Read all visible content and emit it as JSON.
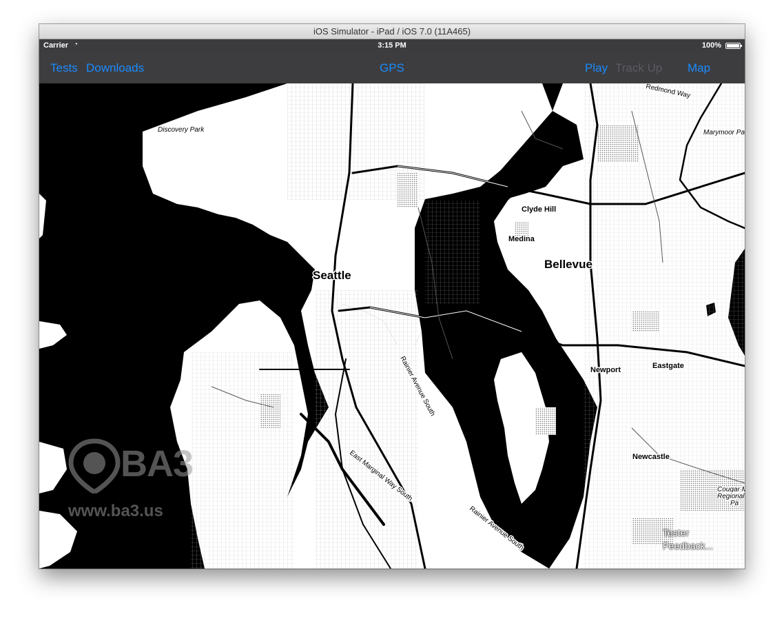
{
  "window": {
    "title": "iOS Simulator - iPad / iOS 7.0 (11A465)"
  },
  "status_bar": {
    "carrier": "Carrier",
    "time": "3:15 PM",
    "battery": "100%"
  },
  "nav_bar": {
    "tests": "Tests",
    "downloads": "Downloads",
    "gps": "GPS",
    "play": "Play",
    "track_up": "Track Up",
    "map": "Map"
  },
  "map": {
    "labels": {
      "discovery_park": "Discovery Park",
      "seattle": "Seattle",
      "clyde_hill": "Clyde Hill",
      "medina": "Medina",
      "bellevue": "Bellevue",
      "newport": "Newport",
      "eastgate": "Eastgate",
      "newcastle": "Newcastle",
      "marymoor": "Marymoor Pa",
      "redmond_way": "Redmond Way",
      "cougar": "Cougar M",
      "regional": "Regional",
      "park": "Pa",
      "rainier_ave_1": "Rainier Avenue South",
      "rainier_ave_2": "Rainier Avenue South",
      "east_marginal": "East Marginal Way South"
    }
  },
  "watermark": {
    "brand": "BA3",
    "url": "www.ba3.us"
  },
  "feedback": {
    "line1": "Tester",
    "line2": "Feedback..."
  },
  "colors": {
    "accent": "#1a8cff",
    "disabled": "#5a5a60",
    "nav_bg": "#3d3d40",
    "status_bg": "#3c3c3e",
    "water": "#000000",
    "land": "#ffffff"
  }
}
